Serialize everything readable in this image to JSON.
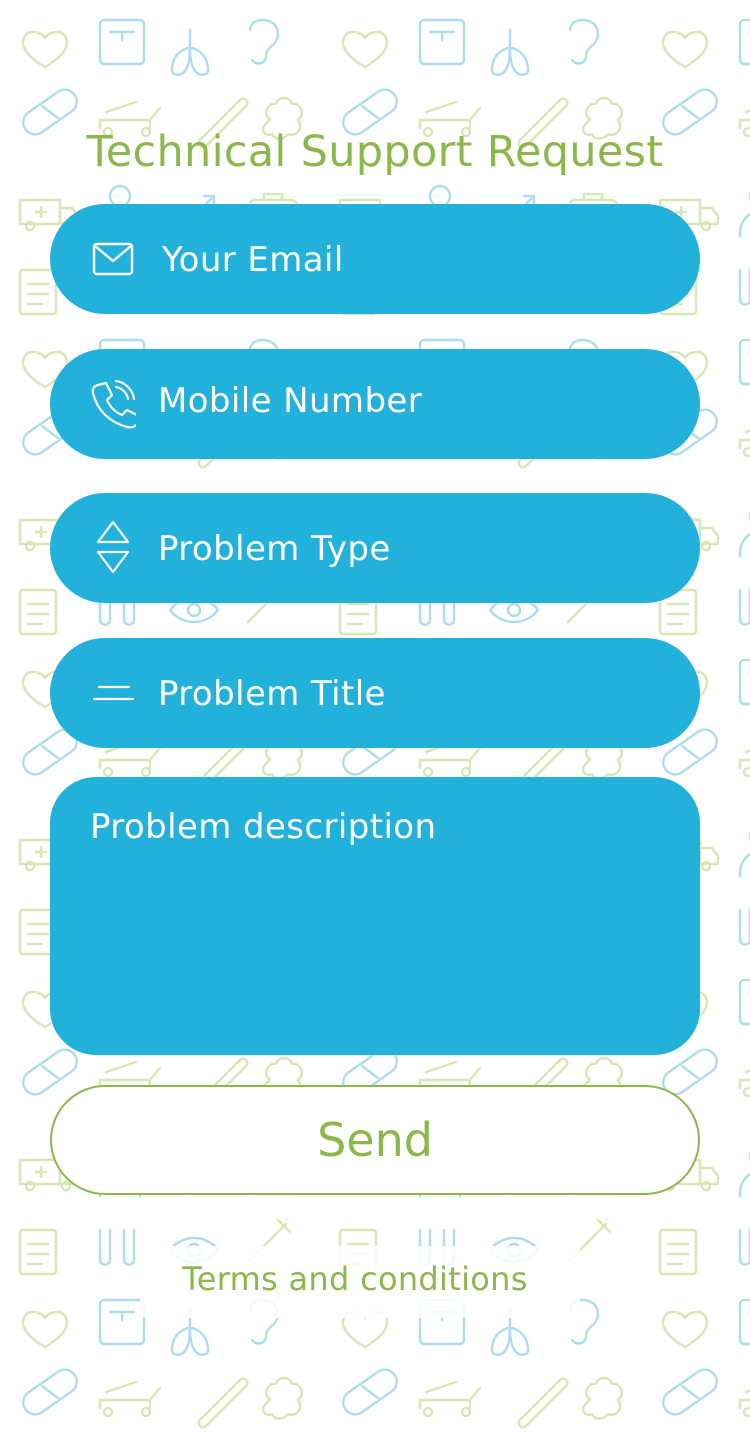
{
  "header": {
    "title": "Technical Support Request"
  },
  "form": {
    "email_placeholder": "Your Email",
    "mobile_placeholder": "Mobile Number",
    "problem_type_placeholder": "Problem Type",
    "problem_title_placeholder": "Problem Title",
    "problem_description_placeholder": "Problem description",
    "send_label": "Send",
    "terms_link": "Terms and conditions"
  },
  "icons": {
    "email": "envelope-icon",
    "mobile": "phone-icon",
    "type": "up-down-arrows-icon",
    "title": "text-lines-icon"
  },
  "colors": {
    "accent_green": "#8cb74a",
    "field_blue": "#21b1da",
    "pattern_blue": "#9ed6ec",
    "pattern_green": "#cfe1a8"
  }
}
